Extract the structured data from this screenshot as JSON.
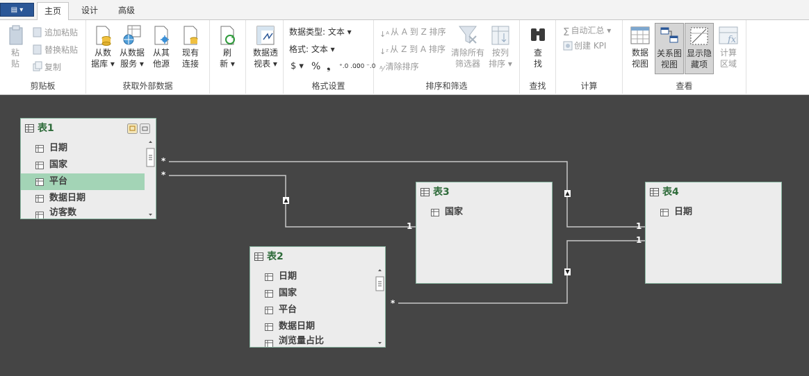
{
  "tabs": {
    "file_label": "▤ ▾",
    "items": [
      {
        "label": "主页",
        "active": true
      },
      {
        "label": "设计",
        "active": false
      },
      {
        "label": "高级",
        "active": false
      }
    ]
  },
  "ribbon": {
    "clipboard": {
      "label": "剪贴板",
      "paste": "粘\n贴",
      "append_paste": "追加粘贴",
      "replace_paste": "替换粘贴",
      "copy": "复制"
    },
    "external": {
      "label": "获取外部数据",
      "from_db": "从数\n据库 ▾",
      "from_service": "从数据\n服务 ▾",
      "from_other": "从其\n他源",
      "existing": "现有\n连接"
    },
    "refresh": {
      "label": "刷\n新 ▾"
    },
    "pivot": {
      "label": "数据透\n视表 ▾"
    },
    "format": {
      "label": "格式设置",
      "data_type": "数据类型: 文本 ▾",
      "format": "格式: 文本 ▾",
      "currency": "$ ▾",
      "percent": "%",
      "comma": "❟",
      "inc_decimal": "⁺.0 .00",
      "dec_decimal": ".00 ⁻.0"
    },
    "sort": {
      "label": "排序和筛选",
      "a_to_z": "从 A 到 Z 排序",
      "z_to_a": "从 Z 到 A 排序",
      "clear_sort": "清除排序",
      "clear_filters": "清除所有\n筛选器",
      "sort_by": "按列\n排序 ▾"
    },
    "find": {
      "label": "查找",
      "find": "查\n找"
    },
    "calc": {
      "label": "计算",
      "autosum": "自动汇总 ▾",
      "kpi": "创建 KPI"
    },
    "view": {
      "label": "查看",
      "data_view": "数据\n视图",
      "diagram_view": "关系图\n视图",
      "show_hidden": "显示隐\n藏项",
      "calc_area": "计算\n区域"
    }
  },
  "tables": [
    {
      "name": "表1",
      "fields": [
        "日期",
        "国家",
        "平台",
        "数据日期",
        "访客数"
      ],
      "selected_field": 2
    },
    {
      "name": "表2",
      "fields": [
        "日期",
        "国家",
        "平台",
        "数据日期",
        "浏览量占比"
      ]
    },
    {
      "name": "表3",
      "fields": [
        "国家"
      ]
    },
    {
      "name": "表4",
      "fields": [
        "日期"
      ]
    }
  ],
  "relations": [
    {
      "from": "表1",
      "to": "表3",
      "from_card": "*",
      "to_card": "1"
    },
    {
      "from": "表1",
      "to": "表4",
      "from_card": "*",
      "to_card": "1"
    },
    {
      "from": "表2",
      "to": "表4",
      "from_card": "*",
      "to_card": "1"
    }
  ],
  "colors": {
    "accent": "#2b5797",
    "table_title": "#2e6b3a",
    "selected_field": "#a3d4b6",
    "canvas": "#454545"
  }
}
